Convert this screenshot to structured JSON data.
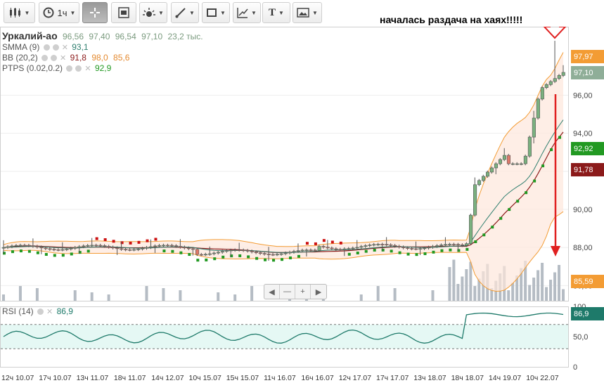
{
  "toolbar": {
    "interval_label": "1ч",
    "text_tool_label": "T"
  },
  "annotation": "началась раздача на хаях!!!!!",
  "legend": {
    "symbol": "Уркалий-ао",
    "quote": [
      "96,56",
      "97,40",
      "96,54",
      "97,10",
      "23,2 тыс."
    ],
    "smma_label": "SMMA (9)",
    "smma_value": "93,1",
    "bb_label": "BB (20,2)",
    "bb_values": [
      "91,8",
      "98,0",
      "85,6"
    ],
    "ptps_label": "PTPS (0.02,0.2)",
    "ptps_value": "92,9",
    "rsi_label": "RSI (14)",
    "rsi_value": "86,9"
  },
  "price_labels": [
    {
      "value": "97,97",
      "color": "#f39c34"
    },
    {
      "value": "97,10",
      "color": "#8fae98"
    },
    {
      "value": "92,92",
      "color": "#229922"
    },
    {
      "value": "91,78",
      "color": "#8b1a1a"
    },
    {
      "value": "85,59",
      "color": "#f39c34"
    },
    {
      "value": "86,9",
      "color": "#1e7a6a"
    }
  ],
  "colors": {
    "up": "#7ab17f",
    "down": "#e07a6a",
    "smma": "#2f7f6f",
    "bb_mid": "#8b1a1a",
    "bb_band": "#f39c34",
    "ptps_up": "#229922",
    "ptps_down": "#cc1111",
    "rsi": "#1e7a6a",
    "arrow": "#e02020"
  },
  "nav_buttons": [
    "◀",
    "—",
    "+",
    "▶"
  ],
  "chart_data": [
    {
      "type": "candlestick",
      "ylim": [
        85.2,
        99.6
      ],
      "price_ticks": [
        "96,00",
        "94,00",
        "92,00",
        "90,00",
        "88,00",
        "86,00"
      ],
      "price_tick_values": [
        96,
        94,
        92,
        90,
        88,
        86
      ],
      "x_tick_labels": [
        "12ч 10.07",
        "17ч 10.07",
        "13ч 11.07",
        "18ч 11.07",
        "14ч 12.07",
        "10ч 15.07",
        "15ч 15.07",
        "11ч 16.07",
        "16ч 16.07",
        "12ч 17.07",
        "17ч 17.07",
        "13ч 18.07",
        "18ч 18.07",
        "14ч 19.07",
        "10ч 22.07"
      ]
    },
    {
      "type": "line",
      "name": "RSI (14)",
      "ylim": [
        0,
        100
      ],
      "ticks": [
        "100",
        "50,0",
        "0"
      ],
      "tick_values": [
        100,
        50,
        0
      ],
      "levels": [
        70,
        30
      ]
    }
  ]
}
